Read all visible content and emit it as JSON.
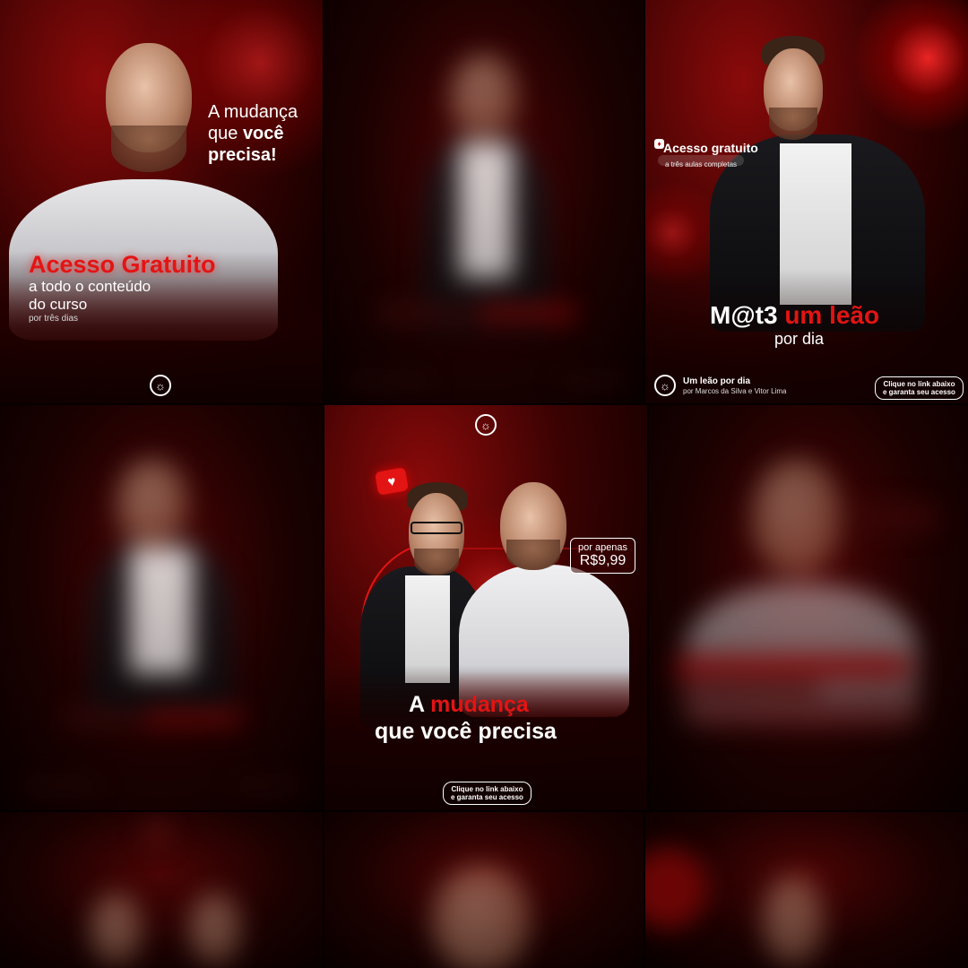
{
  "tile1": {
    "headline_line1": "A mudança",
    "headline_line2_plain": "que ",
    "headline_line2_bold": "você",
    "headline_line3": "precisa!",
    "offer_title": "Acesso Gratuito",
    "offer_line1": "a todo o conteúdo",
    "offer_line2": "do curso",
    "offer_note": "por três dias",
    "logo_icon": "lion-logo-icon"
  },
  "tile3": {
    "badge_title": "Acesso gratuito",
    "badge_subtitle": "a três aulas completas",
    "headline_plain": "M@t3",
    "headline_red": "um leão",
    "headline_line2": "por dia",
    "brand_name": "Um leão por dia",
    "brand_authors": "por Marcos da Silva e Vitor Lima",
    "cta_line1": "Clique no link abaixo",
    "cta_line2": "e garanta seu acesso"
  },
  "tile5": {
    "price_label": "por apenas",
    "price_value": "R$9,99",
    "headline_a": "A ",
    "headline_red": "mudança",
    "headline_line2": "que você precisa",
    "cta_line1": "Clique no link abaixo",
    "cta_line2": "e garanta seu acesso",
    "heart_icon": "heart-icon"
  },
  "colors": {
    "accent_red": "#e31414",
    "background": "#050000",
    "text": "#ffffff"
  }
}
